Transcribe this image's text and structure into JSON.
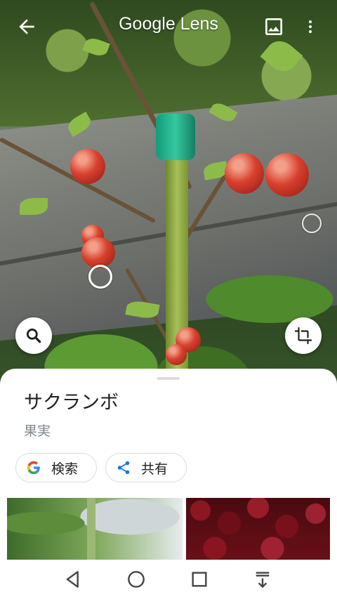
{
  "header": {
    "title": "Google Lens",
    "back_icon": "arrow-back-icon",
    "gallery_icon": "image-icon",
    "more_icon": "more-vert-icon"
  },
  "scene": {
    "description_icons": [
      "search-icon",
      "crop-icon"
    ]
  },
  "result": {
    "title": "サクランボ",
    "category": "果実"
  },
  "actions": [
    {
      "label": "検索",
      "icon": "google-g-icon"
    },
    {
      "label": "共有",
      "icon": "share-icon"
    }
  ],
  "colors": {
    "accent_blue": "#1a73e8",
    "stake_cap": "#22b08a",
    "sheet_bg": "#ffffff"
  },
  "navbar": {
    "icons": [
      "nav-back-icon",
      "nav-home-icon",
      "nav-recents-icon",
      "nav-notifications-icon"
    ]
  }
}
